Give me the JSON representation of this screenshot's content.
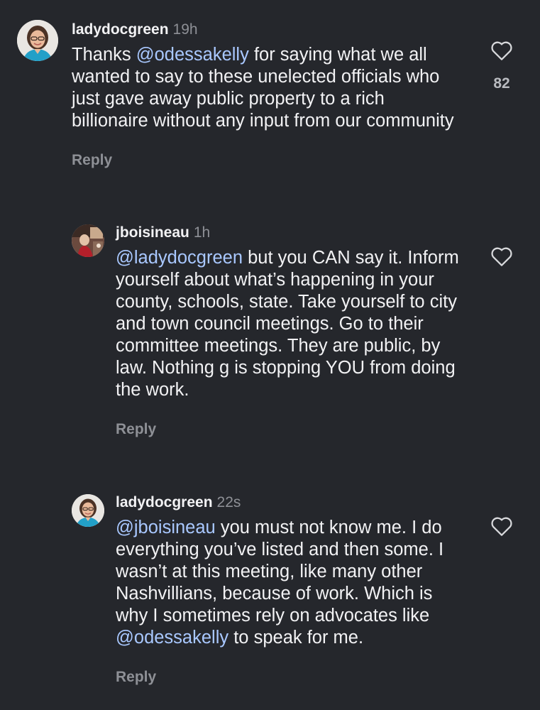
{
  "comments": [
    {
      "username": "ladydocgreen",
      "time": "19h",
      "text_before": "Thanks ",
      "mention": "@odessakelly",
      "text_after": " for saying what we all wanted to say to these unelected officials who just gave away public property to a rich billionaire without any input from our community",
      "reply_label": "Reply",
      "like_count": "82",
      "like_icon": "heart-outline-icon",
      "avatar": "avatar-ladydocgreen"
    },
    {
      "username": "jboisineau",
      "time": "1h",
      "mention": "@ladydocgreen",
      "text_after": " but you CAN say it. Inform yourself about what’s happening in your county, schools, state. Take yourself to city and town council meetings. Go to their committee meetings. They are public, by law. Nothing g is stopping YOU from doing the work.",
      "reply_label": "Reply",
      "like_icon": "heart-outline-icon",
      "avatar": "avatar-jboisineau"
    },
    {
      "username": "ladydocgreen",
      "time": "22s",
      "mention": "@jboisineau",
      "text_middle": " you must not know me. I do everything you’ve listed and then some. I wasn’t at this meeting, like many other Nashvillians, because of work. Which is why I sometimes rely on advocates like ",
      "mention2": "@odessakelly",
      "text_after": " to speak for me.",
      "reply_label": "Reply",
      "like_icon": "heart-outline-icon",
      "avatar": "avatar-ladydocgreen"
    }
  ],
  "colors": {
    "background": "#25272c",
    "text": "#f2f2f4",
    "muted": "#8e9096",
    "mention": "#a9c8ff"
  }
}
